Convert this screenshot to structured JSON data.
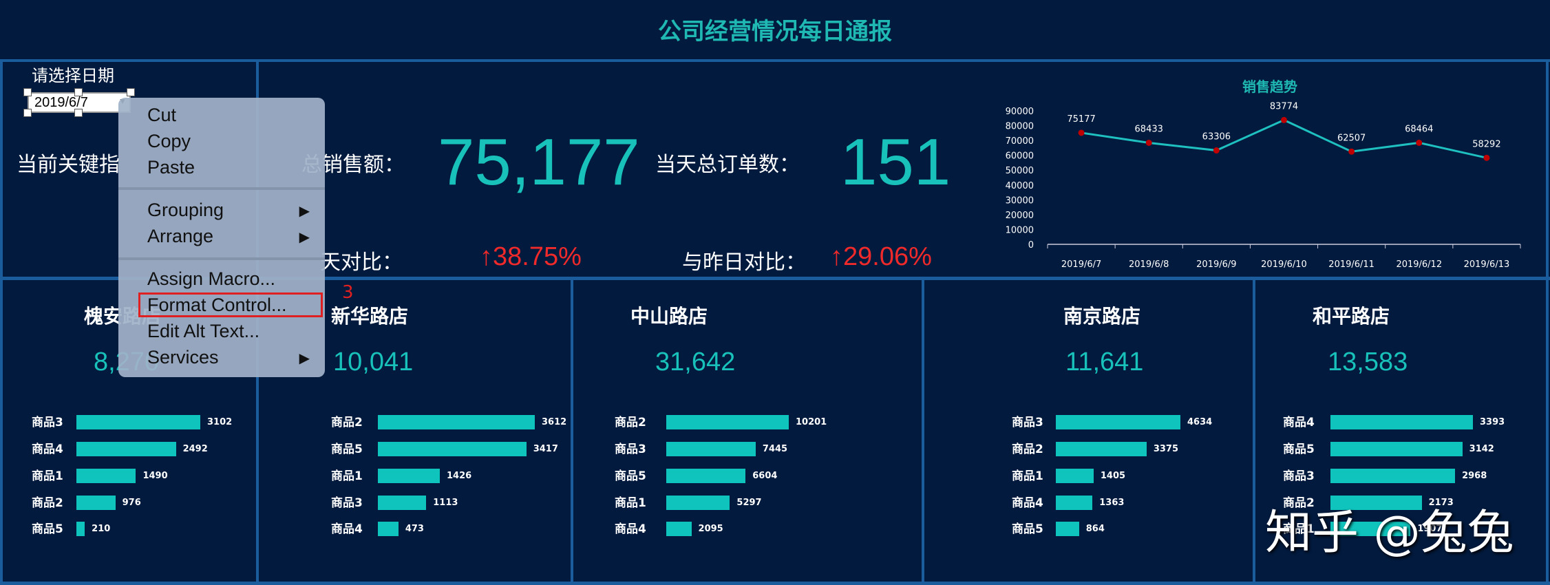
{
  "header": {
    "title": "公司经营情况每日通报"
  },
  "date_picker": {
    "label": "请选择日期",
    "value": "2019/6/7"
  },
  "kpi": {
    "section_label": "当前关键指",
    "sales_label": "总销售额：",
    "sales_value": "75,177",
    "orders_label": "当天总订单数：",
    "orders_value": "151",
    "compare1_label": "天对比：",
    "compare1_value": "↑38.75%",
    "compare2_label": "与昨日对比：",
    "compare2_value": "↑29.06%"
  },
  "context_menu": {
    "items": [
      "Cut",
      "Copy",
      "Paste",
      "Grouping",
      "Arrange",
      "Assign Macro...",
      "Format Control...",
      "Edit Alt Text...",
      "Services"
    ],
    "highlighted": "Format Control...",
    "step_annotation": "3"
  },
  "chart_data": {
    "type": "line",
    "title": "销售趋势",
    "categories": [
      "2019/6/7",
      "2019/6/8",
      "2019/6/9",
      "2019/6/10",
      "2019/6/11",
      "2019/6/12",
      "2019/6/13"
    ],
    "values": [
      75177,
      68433,
      63306,
      83774,
      62507,
      68464,
      58292
    ],
    "yticks": [
      0,
      10000,
      20000,
      30000,
      40000,
      50000,
      60000,
      70000,
      80000,
      90000
    ],
    "ylim": [
      0,
      90000
    ],
    "grid": false,
    "line_color": "#1fc0c0",
    "marker_color": "#c00000"
  },
  "stores": [
    {
      "name": "槐安路店",
      "total": "8,270",
      "products": [
        {
          "name": "商品3",
          "value": 3102
        },
        {
          "name": "商品4",
          "value": 2492
        },
        {
          "name": "商品1",
          "value": 1490
        },
        {
          "name": "商品2",
          "value": 976
        },
        {
          "name": "商品5",
          "value": 210
        }
      ]
    },
    {
      "name": "新华路店",
      "total": "10,041",
      "products": [
        {
          "name": "商品2",
          "value": 3612
        },
        {
          "name": "商品5",
          "value": 3417
        },
        {
          "name": "商品1",
          "value": 1426
        },
        {
          "name": "商品3",
          "value": 1113
        },
        {
          "name": "商品4",
          "value": 473
        }
      ]
    },
    {
      "name": "中山路店",
      "total": "31,642",
      "products": [
        {
          "name": "商品2",
          "value": 10201
        },
        {
          "name": "商品3",
          "value": 7445
        },
        {
          "name": "商品5",
          "value": 6604
        },
        {
          "name": "商品1",
          "value": 5297
        },
        {
          "name": "商品4",
          "value": 2095
        }
      ]
    },
    {
      "name": "南京路店",
      "total": "11,641",
      "products": [
        {
          "name": "商品3",
          "value": 4634
        },
        {
          "name": "商品2",
          "value": 3375
        },
        {
          "name": "商品1",
          "value": 1405
        },
        {
          "name": "商品4",
          "value": 1363
        },
        {
          "name": "商品5",
          "value": 864
        }
      ]
    },
    {
      "name": "和平路店",
      "total": "13,583",
      "products": [
        {
          "name": "商品4",
          "value": 3393
        },
        {
          "name": "商品5",
          "value": 3142
        },
        {
          "name": "商品3",
          "value": 2968
        },
        {
          "name": "商品2",
          "value": 2173
        },
        {
          "name": "商品1",
          "value": 1907
        }
      ]
    }
  ],
  "watermark": "知乎 @兔兔"
}
